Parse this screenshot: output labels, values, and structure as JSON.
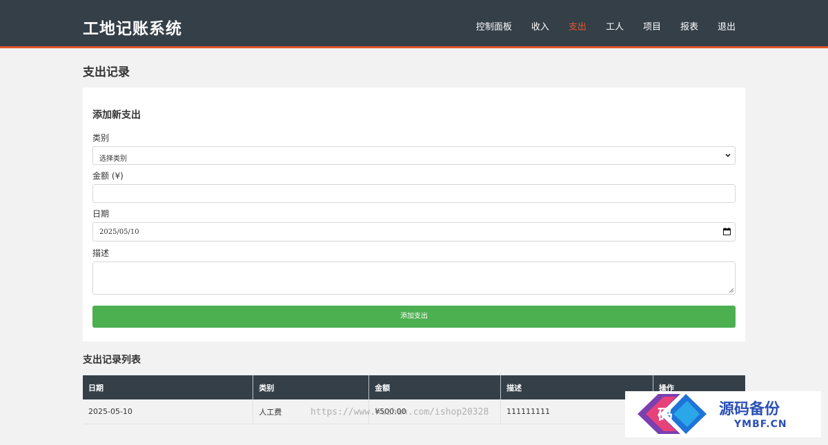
{
  "header": {
    "title": "工地记账系统",
    "nav": [
      "控制面板",
      "收入",
      "支出",
      "工人",
      "项目",
      "报表",
      "退出"
    ],
    "active_index": 2,
    "accent_color": "#e4572e",
    "bg_color": "#343f48"
  },
  "page": {
    "title": "支出记录"
  },
  "form": {
    "heading": "添加新支出",
    "category_label": "类别",
    "category_value": "选择类别",
    "amount_label": "金额 (¥)",
    "amount_value": "",
    "date_label": "日期",
    "date_value": "2025/05/10",
    "description_label": "描述",
    "description_value": "",
    "submit_label": "添加支出",
    "submit_color": "#4caf50"
  },
  "list": {
    "title": "支出记录列表",
    "columns": [
      "日期",
      "类别",
      "金额",
      "描述",
      "操作"
    ],
    "rows": [
      {
        "date": "2025-05-10",
        "category": "人工费",
        "amount": "¥500.00",
        "description": "111111111",
        "action": ""
      }
    ]
  },
  "watermark": {
    "url": "https://www.huzhan.com/ishop20328",
    "logo_icon": "码",
    "logo_cn": "源码备份",
    "logo_en": "YMBF.CN"
  }
}
